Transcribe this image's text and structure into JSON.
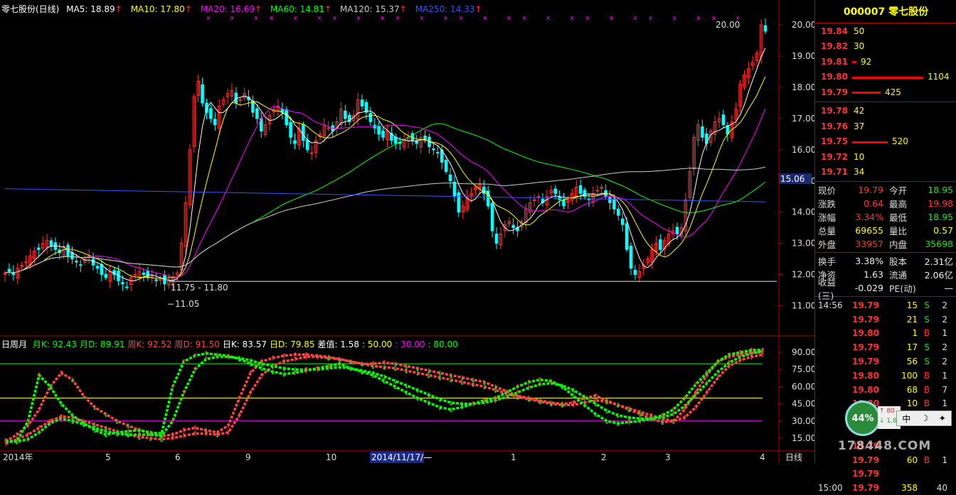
{
  "header": {
    "title": "零七股份(日线)",
    "ma": [
      {
        "label": "MA5: 18.89",
        "color": "#ffffff"
      },
      {
        "label": "MA10: 17.80",
        "color": "#ffff00"
      },
      {
        "label": "MA20: 16.69",
        "color": "#ff00ff"
      },
      {
        "label": "MA60: 14.81",
        "color": "#00ff00"
      },
      {
        "label": "MA120: 15.37",
        "color": "#cccccc"
      },
      {
        "label": "MA250: 14.33",
        "color": "#3355ff"
      }
    ]
  },
  "sub_header": {
    "title": "日周月",
    "items": [
      {
        "label": "月K: 92.43",
        "color": "#00ff00"
      },
      {
        "label": "月D: 89.91",
        "color": "#00ff00"
      },
      {
        "label": "周K: 92.52",
        "color": "#ff4444"
      },
      {
        "label": "周D: 91.50",
        "color": "#ff4444"
      },
      {
        "label": "日K: 83.57",
        "color": "#ffffff"
      },
      {
        "label": "日D: 79.85",
        "color": "#ffff00"
      },
      {
        "label": "差值: 1.58",
        "color": "#ffffff"
      },
      {
        "label": ": 50.00",
        "color": "#ffff00"
      },
      {
        "label": ": 30.00",
        "color": "#ff00ff"
      },
      {
        "label": ": 80.00",
        "color": "#00ff00"
      }
    ]
  },
  "annotations": {
    "high_label": "20.00",
    "low_range": "11.75 - 11.80",
    "low_label": "11.05",
    "current_price_tag": "15.06",
    "cursor_date": "2014/11/17/—",
    "period_label": "日线"
  },
  "chart_data": [
    {
      "type": "candlestick",
      "title": "零七股份(日线)",
      "ylim": [
        10.6,
        20.3
      ],
      "y_ticks": [
        "20.00",
        "19.00",
        "18.00",
        "17.00",
        "16.00",
        "15.00",
        "14.00",
        "13.00",
        "12.00",
        "11.00"
      ],
      "x_ticks": [
        "2014年",
        "5",
        "6",
        "9",
        "10",
        "11",
        "2014/11/17/—",
        "1",
        "2",
        "3",
        "4"
      ],
      "close": [
        12.05,
        12.1,
        12.0,
        12.2,
        12.3,
        12.4,
        12.6,
        12.75,
        12.8,
        13.0,
        13.1,
        12.9,
        12.8,
        12.7,
        12.9,
        12.6,
        12.5,
        12.4,
        12.3,
        12.5,
        12.6,
        12.3,
        12.2,
        12.0,
        11.9,
        12.1,
        12.0,
        11.8,
        11.7,
        11.6,
        11.9,
        12.0,
        12.1,
        12.0,
        11.9,
        11.95,
        11.8,
        11.85,
        11.7,
        11.8,
        11.9,
        12.05,
        13.0,
        14.3,
        16.0,
        17.7,
        18.2,
        17.5,
        17.2,
        17.0,
        16.8,
        17.4,
        17.6,
        17.8,
        17.9,
        17.5,
        17.6,
        17.8,
        17.6,
        17.2,
        17.0,
        16.6,
        16.8,
        17.1,
        17.3,
        17.4,
        17.2,
        16.8,
        16.4,
        16.2,
        16.7,
        16.3,
        16.0,
        15.9,
        16.3,
        16.5,
        16.8,
        16.7,
        16.6,
        16.9,
        17.3,
        17.0,
        16.9,
        17.1,
        17.6,
        17.4,
        17.2,
        16.9,
        16.7,
        16.5,
        16.4,
        16.6,
        16.3,
        16.2,
        16.2,
        16.3,
        16.4,
        16.3,
        16.2,
        16.4,
        16.3,
        16.1,
        16.0,
        15.9,
        15.6,
        15.3,
        15.0,
        14.5,
        14.0,
        14.2,
        14.5,
        14.6,
        14.8,
        14.9,
        14.6,
        14.2,
        13.4,
        13.0,
        13.3,
        13.6,
        13.7,
        13.5,
        13.4,
        13.7,
        14.1,
        14.3,
        14.4,
        14.5,
        14.3,
        14.5,
        14.7,
        14.6,
        14.4,
        14.2,
        14.4,
        14.6,
        14.8,
        14.6,
        14.5,
        14.4,
        14.6,
        14.7,
        14.8,
        14.5,
        14.3,
        14.1,
        13.9,
        13.6,
        12.8,
        12.2,
        12.0,
        12.1,
        12.3,
        12.5,
        12.8,
        13.0,
        12.8,
        13.1,
        13.3,
        13.4,
        13.3,
        13.5,
        14.4,
        15.3,
        16.4,
        16.8,
        16.4,
        16.2,
        16.6,
        16.9,
        17.0,
        16.8,
        16.5,
        16.9,
        17.3,
        18.1,
        18.4,
        18.6,
        18.8,
        19.1,
        20.0,
        19.8
      ],
      "ma": [
        {
          "name": "MA5",
          "color": "#ffffff"
        },
        {
          "name": "MA10",
          "color": "#ffff00"
        },
        {
          "name": "MA20",
          "color": "#ff00ff"
        },
        {
          "name": "MA60",
          "color": "#00ff00"
        },
        {
          "name": "MA120",
          "color": "#cccccc"
        },
        {
          "name": "MA250",
          "color": "#3355ff",
          "values_start": 14.75,
          "values_end": 14.33
        }
      ]
    },
    {
      "type": "line",
      "title": "日周月",
      "ylim": [
        10,
        95
      ],
      "y_ticks": [
        "90.00",
        "75.00",
        "60.00",
        "45.00",
        "30.00",
        "15.00"
      ],
      "reference_lines": [
        {
          "value": 80,
          "color": "#00ff00"
        },
        {
          "value": 50,
          "color": "#ffff00"
        },
        {
          "value": 30,
          "color": "#ff00ff"
        }
      ],
      "series": [
        {
          "name": "周K",
          "color": "#ff4444",
          "values": [
            12,
            18,
            26,
            40,
            60,
            72,
            66,
            52,
            42,
            36,
            30,
            26,
            22,
            19,
            17,
            18,
            22,
            24,
            22,
            20,
            26,
            50,
            72,
            82,
            85,
            87,
            88,
            88,
            87,
            86,
            84,
            82,
            80,
            80,
            81,
            80,
            78,
            76,
            74,
            72,
            70,
            68,
            66,
            64,
            60,
            56,
            52,
            50,
            48,
            46,
            45,
            46,
            50,
            52,
            48,
            44,
            40,
            36,
            32,
            29,
            30,
            40,
            55,
            70,
            82,
            86,
            88,
            90,
            90
          ]
        },
        {
          "name": "周D",
          "color": "#ff4444",
          "values": [
            10,
            14,
            18,
            24,
            30,
            34,
            33,
            30,
            27,
            24,
            21,
            18,
            16,
            15,
            14,
            15,
            17,
            19,
            19,
            18,
            20,
            35,
            55,
            70,
            78,
            82,
            84,
            86,
            86,
            85,
            84,
            82,
            80,
            78,
            77,
            76,
            74,
            72,
            70,
            68,
            66,
            64,
            62,
            60,
            57,
            54,
            51,
            49,
            47,
            45,
            44,
            44,
            46,
            48,
            47,
            44,
            41,
            38,
            35,
            32,
            30,
            33,
            42,
            55,
            68,
            78,
            83,
            86,
            88
          ]
        },
        {
          "name": "月K",
          "color": "#00ff00",
          "values": [
            13,
            12,
            30,
            70,
            60,
            45,
            35,
            28,
            22,
            18,
            20,
            21,
            22,
            20,
            19,
            60,
            82,
            87,
            89,
            88,
            87,
            84,
            80,
            76,
            73,
            71,
            72,
            74,
            76,
            78,
            80,
            76,
            73,
            70,
            65,
            60,
            55,
            50,
            46,
            42,
            40,
            42,
            45,
            48,
            50,
            55,
            60,
            64,
            66,
            65,
            60,
            52,
            44,
            36,
            30,
            28,
            29,
            30,
            32,
            35,
            40,
            50,
            62,
            72,
            82,
            88,
            90,
            92,
            92
          ]
        },
        {
          "name": "月D",
          "color": "#00ff00",
          "values": [
            12,
            12,
            14,
            20,
            28,
            32,
            30,
            27,
            24,
            21,
            19,
            18,
            18,
            18,
            17,
            30,
            55,
            75,
            84,
            86,
            86,
            85,
            83,
            80,
            78,
            76,
            75,
            75,
            75,
            76,
            77,
            76,
            74,
            72,
            69,
            65,
            61,
            57,
            53,
            49,
            46,
            45,
            45,
            46,
            48,
            51,
            55,
            59,
            62,
            63,
            61,
            57,
            51,
            45,
            39,
            35,
            33,
            32,
            32,
            33,
            36,
            43,
            53,
            63,
            73,
            81,
            86,
            89,
            91
          ]
        }
      ]
    }
  ],
  "side_panel": {
    "title": "000007 零七股份",
    "asks": [
      {
        "price": "19.84",
        "vol": "50",
        "bar": 0
      },
      {
        "price": "19.82",
        "vol": "30",
        "bar": 0
      },
      {
        "price": "19.81",
        "vol": "92",
        "bar": 0.06
      },
      {
        "price": "19.80",
        "vol": "1104",
        "bar": 1.0
      },
      {
        "price": "19.79",
        "vol": "425",
        "bar": 0.4
      }
    ],
    "bids": [
      {
        "price": "19.78",
        "vol": "42",
        "bar": 0
      },
      {
        "price": "19.76",
        "vol": "37",
        "bar": 0
      },
      {
        "price": "19.75",
        "vol": "520",
        "bar": 0.5
      },
      {
        "price": "19.72",
        "vol": "10",
        "bar": 0
      },
      {
        "price": "19.71",
        "vol": "34",
        "bar": 0
      }
    ],
    "quote1": [
      {
        "k": "现价",
        "v": "19.79",
        "vc": "red",
        "k2": "今开",
        "v2": "18.95",
        "v2c": "green"
      },
      {
        "k": "涨跌",
        "v": "0.64",
        "vc": "red",
        "k2": "最高",
        "v2": "19.98",
        "v2c": "red"
      },
      {
        "k": "涨幅",
        "v": "3.34%",
        "vc": "red",
        "k2": "最低",
        "v2": "18.95",
        "v2c": "green"
      },
      {
        "k": "总量",
        "v": "69655",
        "vc": "yellow",
        "k2": "量比",
        "v2": "0.57",
        "v2c": "yellow"
      },
      {
        "k": "外盘",
        "v": "33957",
        "vc": "red",
        "k2": "内盘",
        "v2": "35698",
        "v2c": "green"
      }
    ],
    "quote2": [
      {
        "k": "换手",
        "v": "3.38%",
        "vc": "white",
        "k2": "股本",
        "v2": "2.31亿",
        "v2c": "white"
      },
      {
        "k": "净资",
        "v": "1.63",
        "vc": "white",
        "k2": "流通",
        "v2": "2.06亿",
        "v2c": "white"
      },
      {
        "k": "收益(三)",
        "v": "-0.029",
        "vc": "white",
        "k2": "PE(动)",
        "v2": "—",
        "v2c": "white"
      }
    ],
    "ticks": [
      {
        "t": "14:56",
        "p": "19.79",
        "vol": "15",
        "bs": "S",
        "bc": "green",
        "n": "2"
      },
      {
        "t": "",
        "p": "19.79",
        "vol": "21",
        "bs": "S",
        "bc": "green",
        "n": "2"
      },
      {
        "t": "",
        "p": "19.80",
        "vol": "1",
        "bs": "B",
        "bc": "red",
        "n": "1"
      },
      {
        "t": "",
        "p": "19.79",
        "vol": "17",
        "bs": "S",
        "bc": "green",
        "n": "2"
      },
      {
        "t": "",
        "p": "19.79",
        "vol": "56",
        "bs": "S",
        "bc": "green",
        "n": "2"
      },
      {
        "t": "",
        "p": "19.80",
        "vol": "100",
        "bs": "B",
        "bc": "red",
        "n": "1"
      },
      {
        "t": "",
        "p": "19.80",
        "vol": "68",
        "bs": "B",
        "bc": "red",
        "n": "7"
      },
      {
        "t": "",
        "p": "19.80",
        "vol": "10",
        "bs": "B",
        "bc": "red",
        "n": "1"
      },
      {
        "t": "",
        "p": "19.80",
        "vol": "10",
        "bs": "B",
        "bc": "red",
        "n": "2"
      },
      {
        "t": "",
        "p": "",
        "vol": "",
        "bs": "",
        "bc": "red",
        "n": ""
      },
      {
        "t": "",
        "p": "19.79",
        "vol": "",
        "bs": "",
        "bc": "red",
        "n": ""
      },
      {
        "t": "",
        "p": "19.79",
        "vol": "60",
        "bs": "B",
        "bc": "red",
        "n": "1"
      },
      {
        "t": "",
        "p": "19.79",
        "vol": "",
        "bs": "",
        "bc": "red",
        "n": ""
      },
      {
        "t": "15:00",
        "p": "19.79",
        "vol": "358",
        "bs": "",
        "bc": "red",
        "n": "40"
      }
    ],
    "float_badge": "44%",
    "mini_up": "80",
    "mini_down": "1.8",
    "ime_label": "中",
    "watermark": "178448.COM"
  },
  "colors": {
    "up": "#ff3030",
    "down": "#00ffff",
    "axis": "#b00000",
    "grid": "#550000"
  }
}
